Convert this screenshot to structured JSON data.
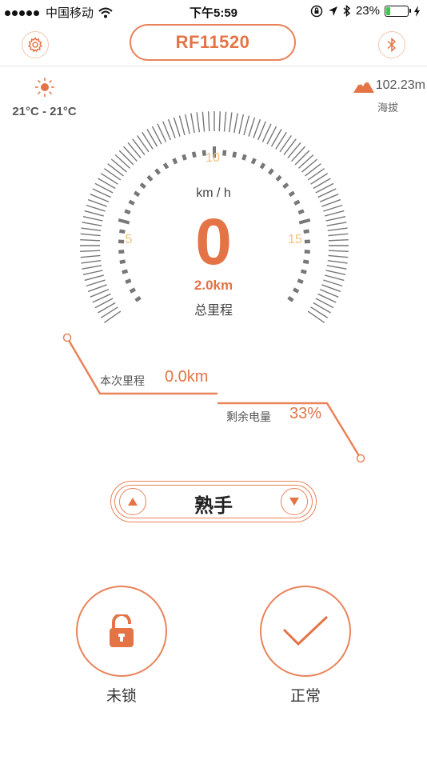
{
  "status_bar": {
    "carrier": "中国移动",
    "time": "下午5:59",
    "battery_percent": "23%",
    "battery_level": 0.23,
    "battery_color": "#3cc84a"
  },
  "header": {
    "device_name": "RF11520",
    "settings_icon": "gear-icon",
    "bluetooth_icon": "bluetooth-icon"
  },
  "weather": {
    "icon": "sun-icon",
    "temperature_range": "21°C - 21°C"
  },
  "altitude": {
    "icon": "mountain-icon",
    "value": "102.23m",
    "label": "海拔"
  },
  "speedometer": {
    "unit": "km / h",
    "speed": "0",
    "tick_labels": [
      "5",
      "10",
      "15"
    ],
    "total_distance": "2.0km",
    "total_label": "总里程"
  },
  "trip": {
    "label": "本次里程",
    "value": "0.0km"
  },
  "battery": {
    "label": "剩余电量",
    "value": "33%"
  },
  "mode": {
    "label": "熟手",
    "up_icon": "triangle-up-icon",
    "down_icon": "triangle-down-icon"
  },
  "actions": {
    "lock_label": "未锁",
    "lock_icon": "unlocked-padlock-icon",
    "status_label": "正常",
    "status_icon": "checkmark-icon"
  },
  "colors": {
    "accent": "#e47446",
    "tick_label": "#f2c07a",
    "gauge_gray": "#777777"
  }
}
